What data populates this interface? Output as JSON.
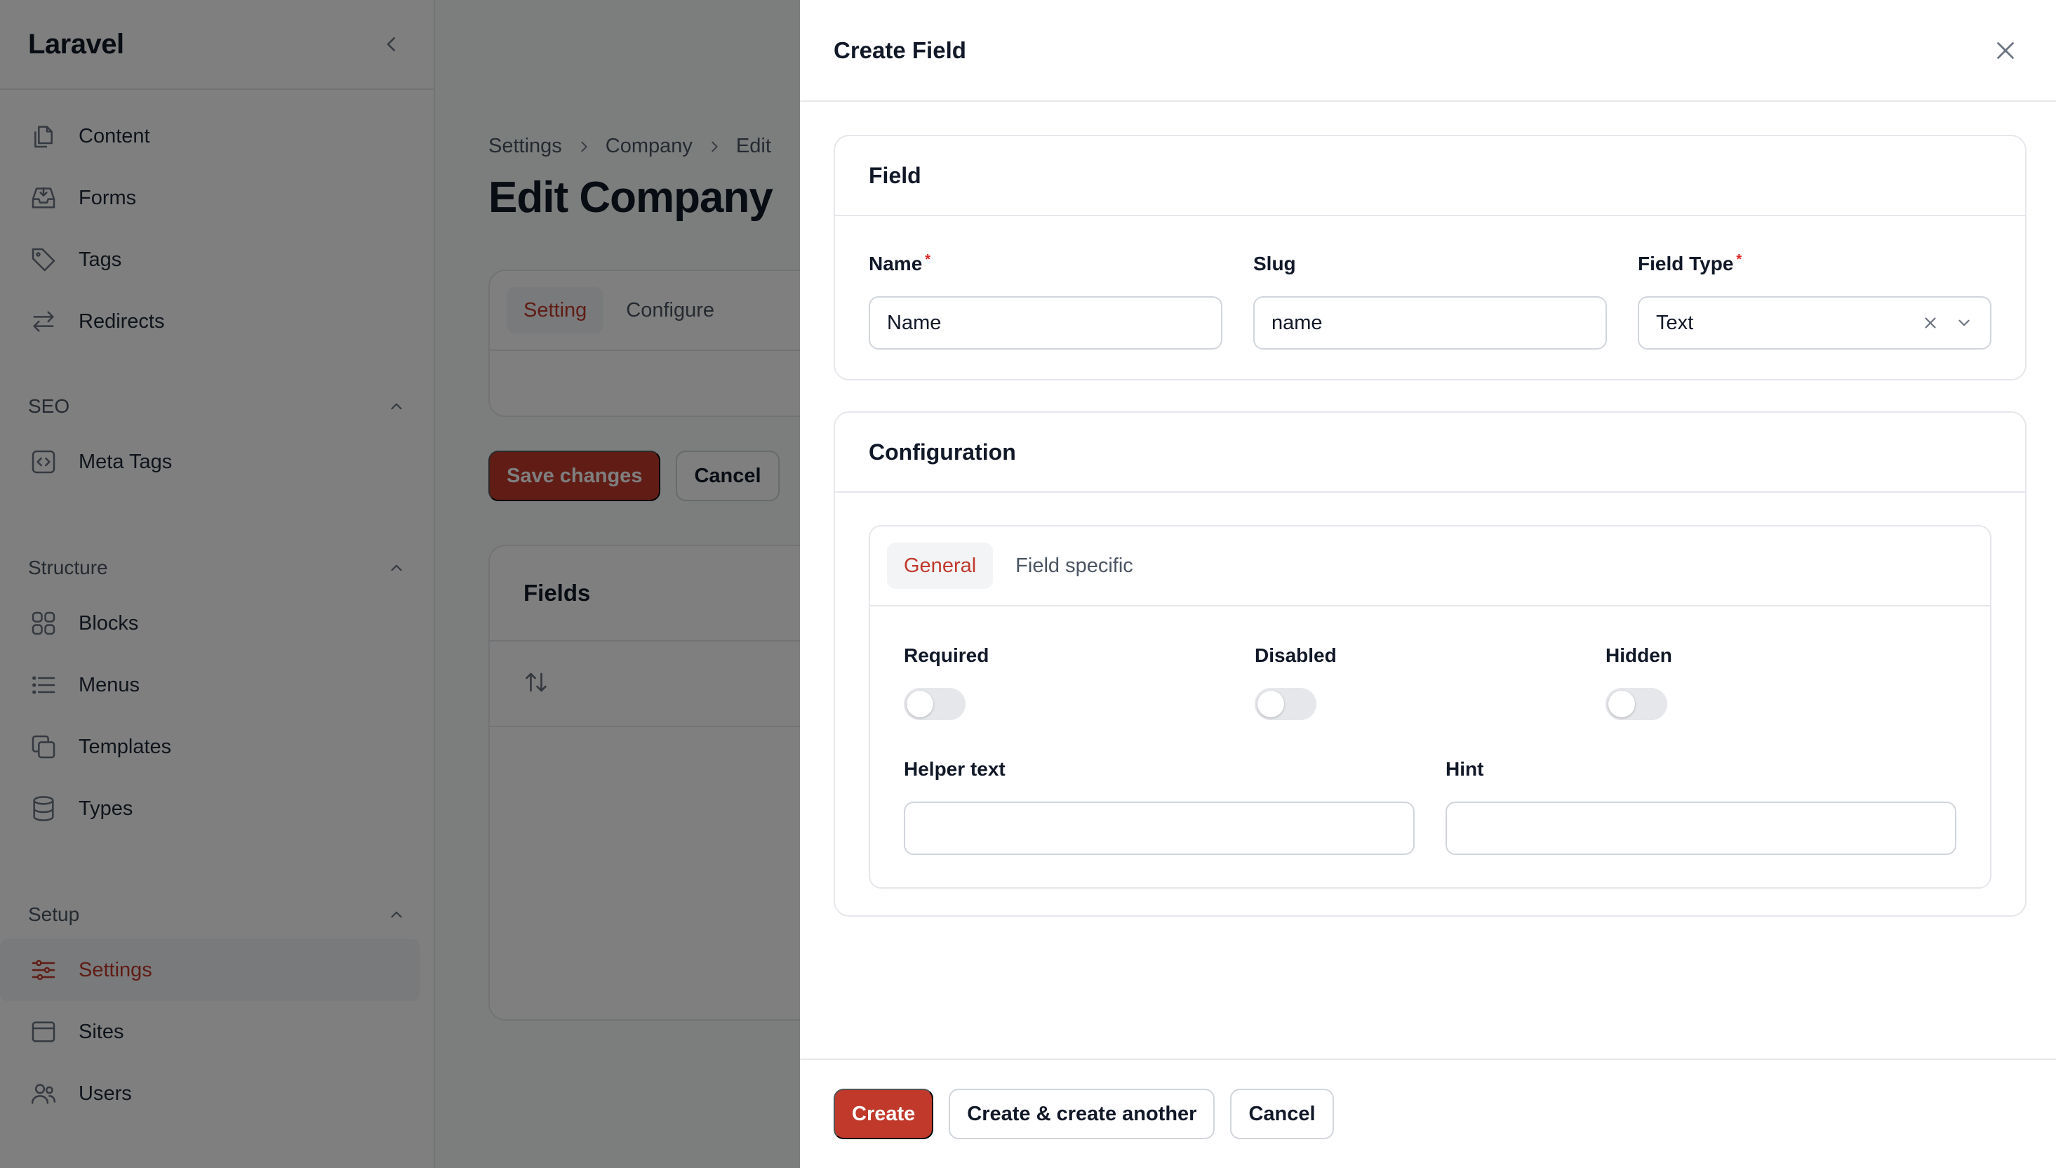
{
  "sidebar": {
    "brand": "Laravel",
    "items_top": [
      {
        "label": "Content",
        "icon": "document-duplicate-icon"
      },
      {
        "label": "Forms",
        "icon": "inbox-icon"
      },
      {
        "label": "Tags",
        "icon": "tag-icon"
      },
      {
        "label": "Redirects",
        "icon": "arrows-right-left-icon"
      }
    ],
    "groups": [
      {
        "label": "SEO",
        "items": [
          {
            "label": "Meta Tags",
            "icon": "code-bracket-square-icon"
          }
        ]
      },
      {
        "label": "Structure",
        "items": [
          {
            "label": "Blocks",
            "icon": "squares-icon"
          },
          {
            "label": "Menus",
            "icon": "list-bullet-icon"
          },
          {
            "label": "Templates",
            "icon": "square-stack-icon"
          },
          {
            "label": "Types",
            "icon": "circle-stack-icon"
          }
        ]
      },
      {
        "label": "Setup",
        "items": [
          {
            "label": "Settings",
            "icon": "adjustments-icon",
            "active": true
          },
          {
            "label": "Sites",
            "icon": "window-icon"
          },
          {
            "label": "Users",
            "icon": "users-icon"
          }
        ]
      }
    ]
  },
  "main": {
    "breadcrumbs": [
      "Settings",
      "Company",
      "Edit"
    ],
    "title": "Edit Company",
    "tabs": [
      "Setting",
      "Configure"
    ],
    "save_label": "Save changes",
    "cancel_label": "Cancel",
    "fields_heading": "Fields"
  },
  "modal": {
    "title": "Create Field",
    "field_section": {
      "heading": "Field",
      "name": {
        "label": "Name",
        "value": "Name"
      },
      "slug": {
        "label": "Slug",
        "value": "name"
      },
      "field_type": {
        "label": "Field Type",
        "value": "Text"
      }
    },
    "config_section": {
      "heading": "Configuration",
      "tabs": [
        "General",
        "Field specific"
      ],
      "toggles": [
        {
          "label": "Required",
          "on": false
        },
        {
          "label": "Disabled",
          "on": false
        },
        {
          "label": "Hidden",
          "on": false
        }
      ],
      "helper_text": {
        "label": "Helper text",
        "value": ""
      },
      "hint": {
        "label": "Hint",
        "value": ""
      }
    },
    "footer": {
      "create": "Create",
      "create_another": "Create & create another",
      "cancel": "Cancel"
    }
  },
  "colors": {
    "accent": "#c0392b",
    "required": "#dc2626"
  }
}
